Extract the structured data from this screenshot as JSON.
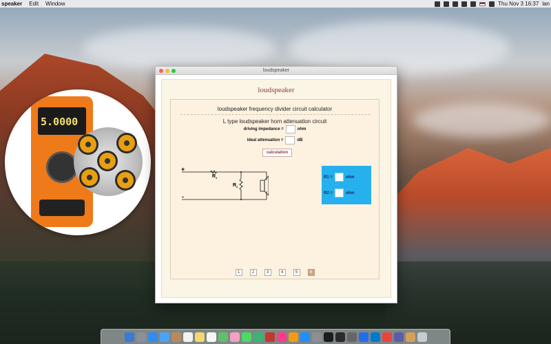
{
  "menubar": {
    "app_name": "speaker",
    "items": [
      "Edit",
      "Window"
    ],
    "clock": "Thu Nov 3  16:37",
    "user": "lan"
  },
  "promo": {
    "meter_reading": "5.0000"
  },
  "window": {
    "title": "loudspeaker",
    "app_title": "loudspeaker",
    "calc_title": "loudspeaker frequency divider circuit calculator",
    "sub_title": "L type loudspeaker horn attenuation circuit",
    "driving_impedance_label": "driving impedance =",
    "driving_impedance_value": "",
    "driving_impedance_unit": "ohm",
    "ideal_attenuation_label": "ideal attenuation =",
    "ideal_attenuation_value": "",
    "ideal_attenuation_unit": "dB",
    "calc_button": "calculation",
    "circuit": {
      "plus": "+",
      "minus": "-",
      "r1": "R",
      "r1_sub": "1",
      "r2": "R",
      "r2_sub": "2"
    },
    "results": {
      "r1_label": "R1 =",
      "r1_value": "",
      "r1_unit": "ohm",
      "r2_label": "R2 =",
      "r2_value": "",
      "r2_unit": "ohm",
      "color": "#27b0ee"
    },
    "pages": [
      "1",
      "2",
      "3",
      "4",
      "5",
      "6"
    ],
    "active_page": "6"
  },
  "dock": {
    "icons": [
      "finder-icon",
      "launchpad-icon",
      "safari-icon",
      "mail-icon",
      "contacts-icon",
      "calendar-icon",
      "notes-icon",
      "reminders-icon",
      "maps-icon",
      "photos-icon",
      "messages-icon",
      "facetime-icon",
      "photo-booth-icon",
      "itunes-icon",
      "ibooks-icon",
      "app-store-icon",
      "system-preferences-icon",
      "terminal-icon",
      "console-icon",
      "calculator-icon",
      "xcode-icon",
      "vscode-icon",
      "chrome-icon",
      "app-icon",
      "loudspeaker-app-icon",
      "trash-icon"
    ]
  }
}
